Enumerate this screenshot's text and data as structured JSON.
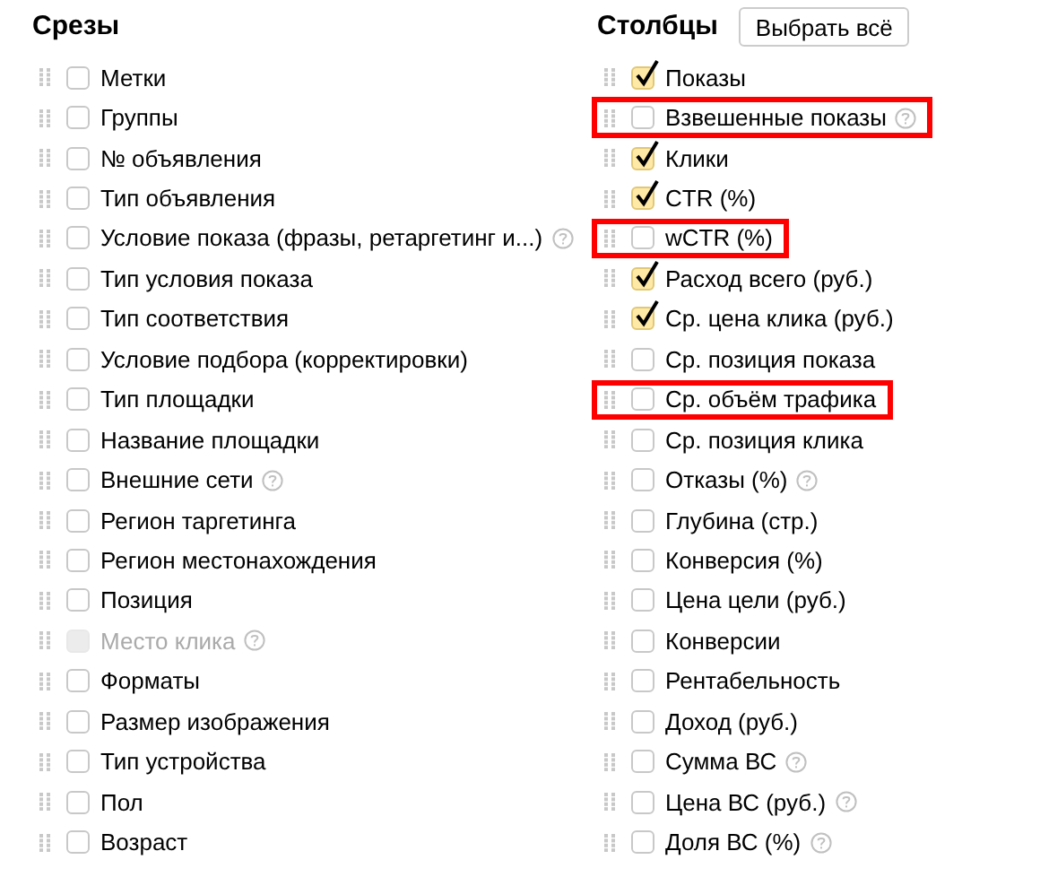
{
  "slices": {
    "title": "Срезы",
    "items": [
      {
        "label": "Метки",
        "checked": false,
        "disabled": false,
        "help": false
      },
      {
        "label": "Группы",
        "checked": false,
        "disabled": false,
        "help": false
      },
      {
        "label": "№ объявления",
        "checked": false,
        "disabled": false,
        "help": false
      },
      {
        "label": "Тип объявления",
        "checked": false,
        "disabled": false,
        "help": false
      },
      {
        "label": "Условие показа (фразы, ретаргетинг и...)",
        "checked": false,
        "disabled": false,
        "help": true
      },
      {
        "label": "Тип условия показа",
        "checked": false,
        "disabled": false,
        "help": false
      },
      {
        "label": "Тип соответствия",
        "checked": false,
        "disabled": false,
        "help": false
      },
      {
        "label": "Условие подбора (корректировки)",
        "checked": false,
        "disabled": false,
        "help": false
      },
      {
        "label": "Тип площадки",
        "checked": false,
        "disabled": false,
        "help": false
      },
      {
        "label": "Название площадки",
        "checked": false,
        "disabled": false,
        "help": false
      },
      {
        "label": "Внешние сети",
        "checked": false,
        "disabled": false,
        "help": true
      },
      {
        "label": "Регион таргетинга",
        "checked": false,
        "disabled": false,
        "help": false
      },
      {
        "label": "Регион местонахождения",
        "checked": false,
        "disabled": false,
        "help": false
      },
      {
        "label": "Позиция",
        "checked": false,
        "disabled": false,
        "help": false
      },
      {
        "label": "Место клика",
        "checked": false,
        "disabled": true,
        "help": true
      },
      {
        "label": "Форматы",
        "checked": false,
        "disabled": false,
        "help": false
      },
      {
        "label": "Размер изображения",
        "checked": false,
        "disabled": false,
        "help": false
      },
      {
        "label": "Тип устройства",
        "checked": false,
        "disabled": false,
        "help": false
      },
      {
        "label": "Пол",
        "checked": false,
        "disabled": false,
        "help": false
      },
      {
        "label": "Возраст",
        "checked": false,
        "disabled": false,
        "help": false
      }
    ]
  },
  "columns": {
    "title": "Столбцы",
    "select_all_button": "Выбрать всё",
    "items": [
      {
        "label": "Показы",
        "checked": true,
        "help": false,
        "highlighted": false
      },
      {
        "label": "Взвешенные показы",
        "checked": false,
        "help": true,
        "highlighted": true
      },
      {
        "label": "Клики",
        "checked": true,
        "help": false,
        "highlighted": false
      },
      {
        "label": "CTR (%)",
        "checked": true,
        "help": false,
        "highlighted": false
      },
      {
        "label": "wCTR (%)",
        "checked": false,
        "help": false,
        "highlighted": true
      },
      {
        "label": "Расход всего (руб.)",
        "checked": true,
        "help": false,
        "highlighted": false
      },
      {
        "label": "Ср. цена клика (руб.)",
        "checked": true,
        "help": false,
        "highlighted": false
      },
      {
        "label": "Ср. позиция показа",
        "checked": false,
        "help": false,
        "highlighted": false
      },
      {
        "label": "Ср. объём трафика",
        "checked": false,
        "help": false,
        "highlighted": true
      },
      {
        "label": "Ср. позиция клика",
        "checked": false,
        "help": false,
        "highlighted": false
      },
      {
        "label": "Отказы (%)",
        "checked": false,
        "help": true,
        "highlighted": false
      },
      {
        "label": "Глубина (стр.)",
        "checked": false,
        "help": false,
        "highlighted": false
      },
      {
        "label": "Конверсия (%)",
        "checked": false,
        "help": false,
        "highlighted": false
      },
      {
        "label": "Цена цели (руб.)",
        "checked": false,
        "help": false,
        "highlighted": false
      },
      {
        "label": "Конверсии",
        "checked": false,
        "help": false,
        "highlighted": false
      },
      {
        "label": "Рентабельность",
        "checked": false,
        "help": false,
        "highlighted": false
      },
      {
        "label": "Доход (руб.)",
        "checked": false,
        "help": false,
        "highlighted": false
      },
      {
        "label": "Сумма ВС",
        "checked": false,
        "help": true,
        "highlighted": false
      },
      {
        "label": "Цена ВС (руб.)",
        "checked": false,
        "help": true,
        "highlighted": false
      },
      {
        "label": "Доля ВС (%)",
        "checked": false,
        "help": true,
        "highlighted": false
      }
    ]
  }
}
